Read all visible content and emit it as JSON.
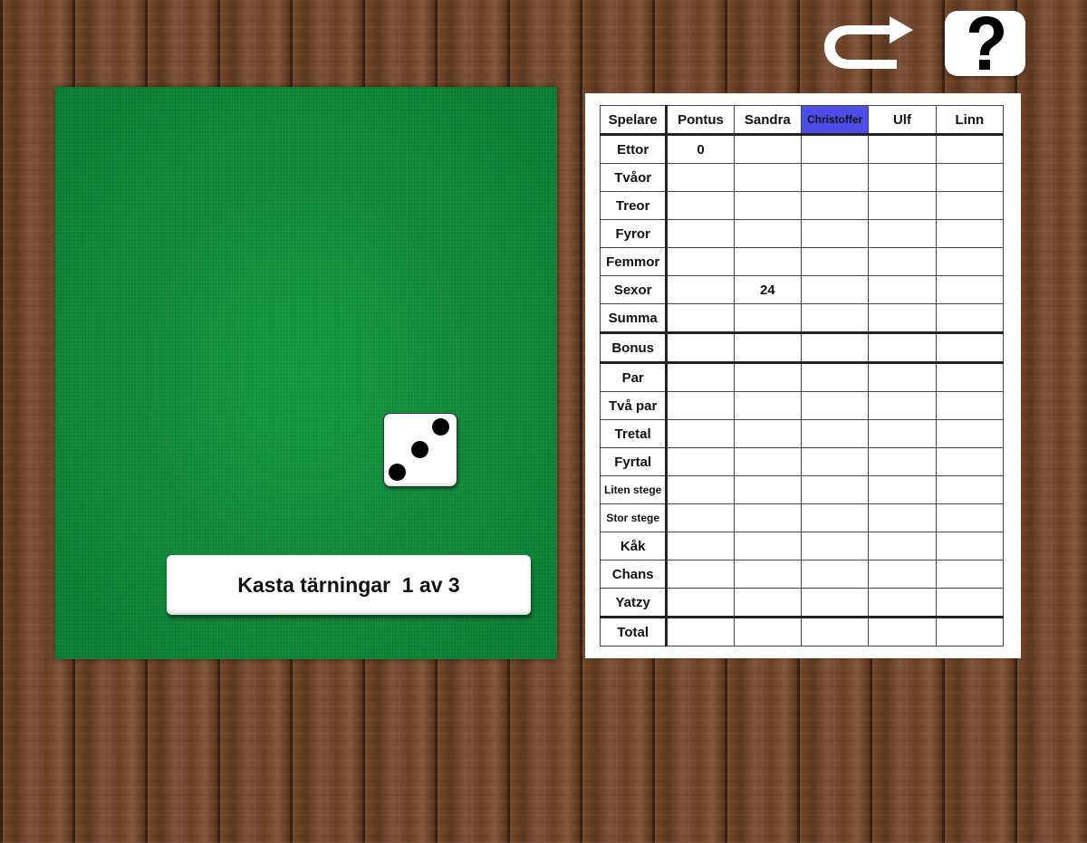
{
  "controls": {
    "undo_icon": "undo-arrow-icon",
    "help_icon": "question-mark-icon",
    "help_label": "?"
  },
  "board": {
    "die": {
      "value": 3
    },
    "roll_button_label": "Kasta tärningar  1 av 3"
  },
  "scorecard": {
    "header_label": "Spelare",
    "players": [
      {
        "name": "Pontus",
        "active": false
      },
      {
        "name": "Sandra",
        "active": false
      },
      {
        "name": "Christoffer",
        "active": true
      },
      {
        "name": "Ulf",
        "active": false
      },
      {
        "name": "Linn",
        "active": false
      }
    ],
    "active_color": "#4e4ee6",
    "rows": [
      {
        "label": "Ettor",
        "scores": [
          "0",
          "",
          "",
          "",
          ""
        ]
      },
      {
        "label": "Tvåor",
        "scores": [
          "",
          "",
          "",
          "",
          ""
        ]
      },
      {
        "label": "Treor",
        "scores": [
          "",
          "",
          "",
          "",
          ""
        ]
      },
      {
        "label": "Fyror",
        "scores": [
          "",
          "",
          "",
          "",
          ""
        ]
      },
      {
        "label": "Femmor",
        "scores": [
          "",
          "",
          "",
          "",
          ""
        ]
      },
      {
        "label": "Sexor",
        "scores": [
          "",
          "24",
          "",
          "",
          ""
        ]
      },
      {
        "label": "Summa",
        "scores": [
          "",
          "",
          "",
          "",
          ""
        ]
      },
      {
        "label": "Bonus",
        "scores": [
          "",
          "",
          "",
          "",
          ""
        ]
      },
      {
        "label": "Par",
        "scores": [
          "",
          "",
          "",
          "",
          ""
        ]
      },
      {
        "label": "Två par",
        "scores": [
          "",
          "",
          "",
          "",
          ""
        ]
      },
      {
        "label": "Tretal",
        "scores": [
          "",
          "",
          "",
          "",
          ""
        ]
      },
      {
        "label": "Fyrtal",
        "scores": [
          "",
          "",
          "",
          "",
          ""
        ]
      },
      {
        "label": "Liten stege",
        "scores": [
          "",
          "",
          "",
          "",
          ""
        ]
      },
      {
        "label": "Stor stege",
        "scores": [
          "",
          "",
          "",
          "",
          ""
        ]
      },
      {
        "label": "Kåk",
        "scores": [
          "",
          "",
          "",
          "",
          ""
        ]
      },
      {
        "label": "Chans",
        "scores": [
          "",
          "",
          "",
          "",
          ""
        ]
      },
      {
        "label": "Yatzy",
        "scores": [
          "",
          "",
          "",
          "",
          ""
        ]
      },
      {
        "label": "Total",
        "scores": [
          "",
          "",
          "",
          "",
          ""
        ]
      }
    ]
  }
}
